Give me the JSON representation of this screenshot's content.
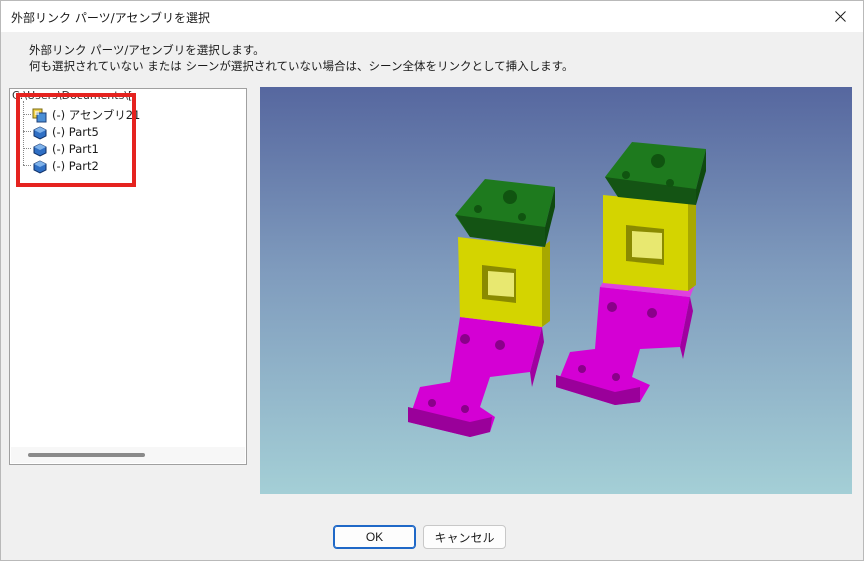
{
  "window": {
    "title": "外部リンク パーツ/アセンブリを選択",
    "close_icon": "close-icon"
  },
  "description": {
    "line1": "外部リンク パーツ/アセンブリを選択します。",
    "line2": "何も選択されていない または シーンが選択されていない場合は、シーン全体をリンクとして挿入します。"
  },
  "tree": {
    "root_label": "C:\\Users\\Documents\\[",
    "items": [
      {
        "label": "(-) アセンブリ21",
        "icon": "assembly-icon"
      },
      {
        "label": "(-) Part5",
        "icon": "part-icon"
      },
      {
        "label": "(-) Part1",
        "icon": "part-icon"
      },
      {
        "label": "(-) Part2",
        "icon": "part-icon"
      }
    ]
  },
  "colors": {
    "highlight": "#e5231f",
    "part_green": "#1e7a1e",
    "part_yellow": "#d4d400",
    "part_magenta": "#d400d4",
    "viewport_top": "#56679f",
    "viewport_bottom": "#a4cfd6"
  },
  "buttons": {
    "ok": "OK",
    "cancel": "キャンセル"
  }
}
